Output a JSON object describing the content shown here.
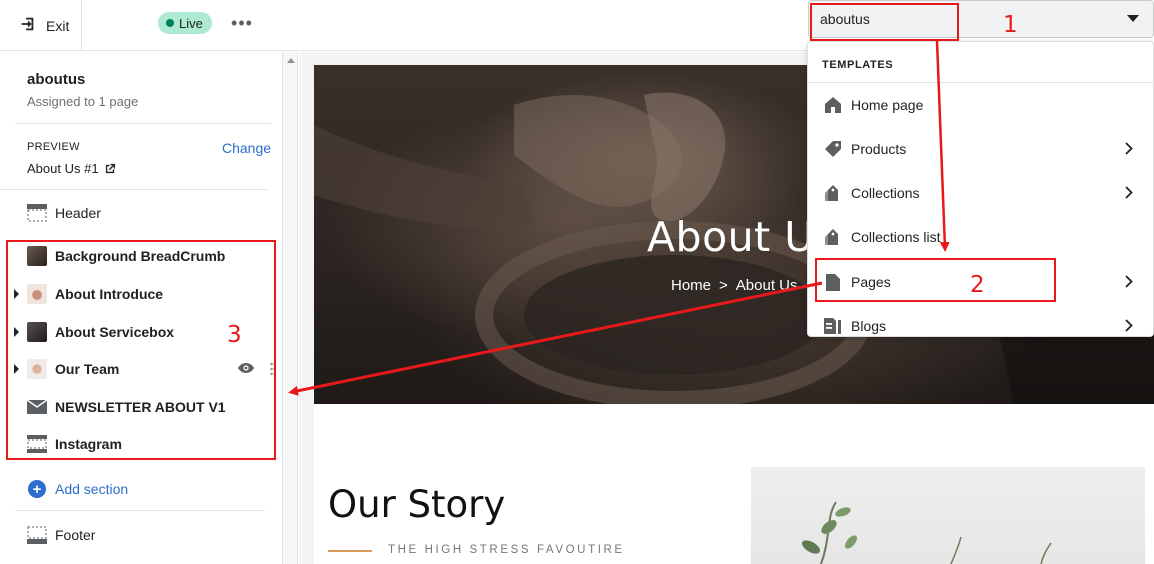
{
  "topbar": {
    "exit_label": "Exit",
    "live_label": "Live",
    "more_label": "•••"
  },
  "template_select": {
    "value": "aboutus"
  },
  "sidebar": {
    "template_name": "aboutus",
    "assigned": "Assigned to 1 page",
    "preview_label": "PREVIEW",
    "change_label": "Change",
    "preview_value": "About Us #1",
    "header": "Header",
    "sections": [
      {
        "label": "Background BreadCrumb"
      },
      {
        "label": "About Introduce"
      },
      {
        "label": "About Servicebox"
      },
      {
        "label": "Our Team"
      },
      {
        "label": "NEWSLETTER ABOUT V1"
      },
      {
        "label": "Instagram"
      }
    ],
    "add_section": "Add section",
    "footer": "Footer"
  },
  "preview": {
    "hero_title": "About Us",
    "crumb_home": "Home",
    "crumb_sep": ">",
    "crumb_current": "About Us",
    "story_title": "Our Story",
    "story_subtitle": "THE HIGH STRESS FAVOUTIRE"
  },
  "menu": {
    "heading": "TEMPLATES",
    "items": [
      {
        "label": "Home page",
        "icon": "home-icon"
      },
      {
        "label": "Products",
        "icon": "tag-icon"
      },
      {
        "label": "Collections",
        "icon": "collections-icon"
      },
      {
        "label": "Collections list",
        "icon": "collections-list-icon"
      },
      {
        "label": "Pages",
        "icon": "page-icon"
      },
      {
        "label": "Blogs",
        "icon": "blog-icon"
      }
    ]
  },
  "annotations": {
    "n1": "1",
    "n2": "2",
    "n3": "3",
    "color": "#e8191b"
  },
  "colors": {
    "accent": "#2c6ecb",
    "live_bg": "#aee9d1",
    "live_dot": "#007f5f"
  }
}
